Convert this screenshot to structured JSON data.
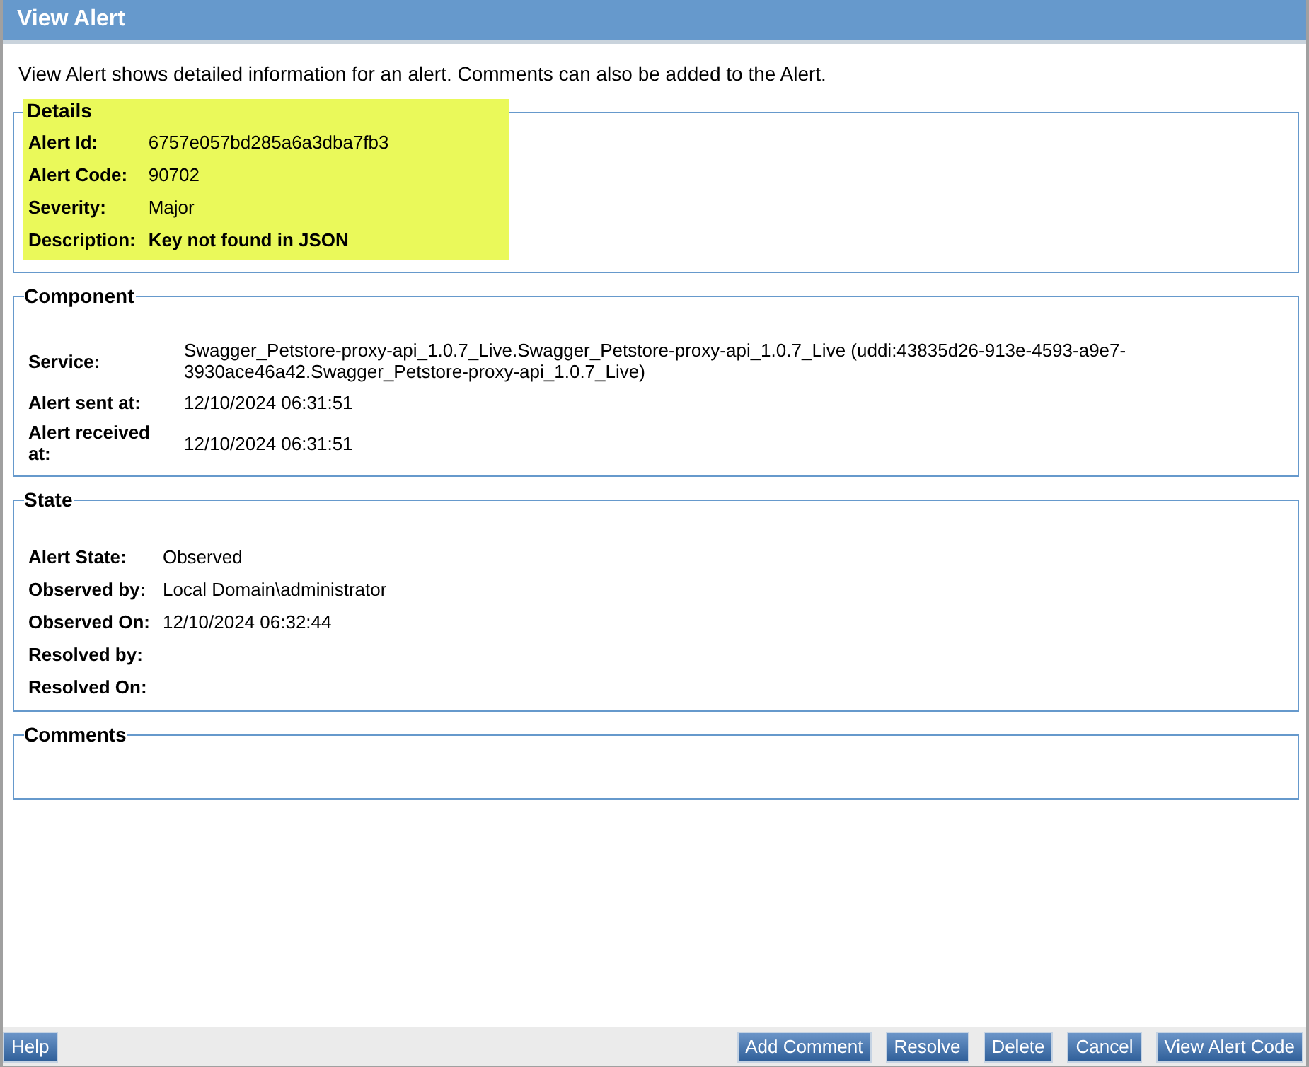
{
  "header": {
    "title": "View Alert"
  },
  "intro": "View Alert shows detailed information for an alert. Comments can also be added to the Alert.",
  "sections": [
    {
      "legend": "Details",
      "highlighted": true,
      "fields": [
        {
          "label": "Alert Id:",
          "value": "6757e057bd285a6a3dba7fb3",
          "bold": false
        },
        {
          "label": "Alert Code:",
          "value": "90702",
          "bold": false
        },
        {
          "label": "Severity:",
          "value": "Major",
          "bold": false
        },
        {
          "label": "Description:",
          "value": "Key not found in JSON",
          "bold": true
        }
      ]
    },
    {
      "legend": "Component",
      "highlighted": false,
      "fields": [
        {
          "label": "Service:",
          "value": "Swagger_Petstore-proxy-api_1.0.7_Live.Swagger_Petstore-proxy-api_1.0.7_Live (uddi:43835d26-913e-4593-a9e7-3930ace46a42.Swagger_Petstore-proxy-api_1.0.7_Live)",
          "bold": false
        },
        {
          "label": "Alert sent at:",
          "value": "12/10/2024 06:31:51",
          "bold": false
        },
        {
          "label": "Alert received at:",
          "value": "12/10/2024 06:31:51",
          "bold": false
        }
      ]
    },
    {
      "legend": "State",
      "highlighted": false,
      "fields": [
        {
          "label": "Alert State:",
          "value": "Observed",
          "bold": false
        },
        {
          "label": "Observed by:",
          "value": "Local Domain\\administrator",
          "bold": false
        },
        {
          "label": "Observed On:",
          "value": "12/10/2024 06:32:44",
          "bold": false
        },
        {
          "label": "Resolved by:"
        },
        {
          "label": "Resolved On:"
        }
      ]
    },
    {
      "legend": "Comments",
      "highlighted": false
    }
  ],
  "footer": {
    "left_buttons": [
      "Help"
    ],
    "right_buttons": [
      "Add Comment",
      "Resolve",
      "Delete",
      "Cancel",
      "View Alert Code"
    ]
  }
}
